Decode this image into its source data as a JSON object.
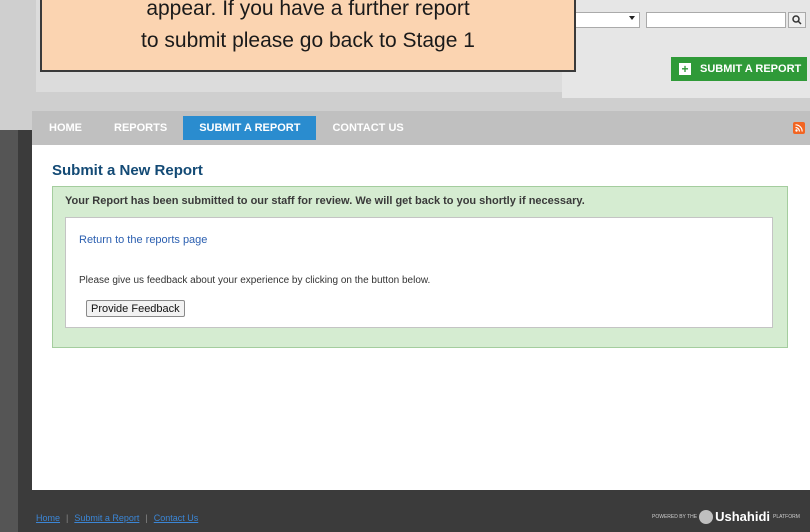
{
  "tooltip": {
    "line1": "appear. If you have a further report",
    "line2": "to submit please go back to Stage 1"
  },
  "header": {
    "submit_button": "SUBMIT A REPORT",
    "search": {
      "placeholder": ""
    }
  },
  "nav": {
    "items": [
      "HOME",
      "REPORTS",
      "SUBMIT A REPORT",
      "CONTACT US"
    ],
    "active": "SUBMIT A REPORT"
  },
  "main": {
    "title": "Submit a New Report",
    "success_message": "Your Report has been submitted to our staff for review. We will get back to you shortly if necessary.",
    "return_link": "Return to the reports page",
    "feedback_text": "Please give us feedback about your experience by clicking on the button below.",
    "feedback_button": "Provide Feedback"
  },
  "footer": {
    "links": [
      "Home",
      "Submit a Report",
      "Contact Us"
    ],
    "powered_prefix": "POWERED BY THE",
    "brand": "Ushahidi",
    "powered_suffix": "PLATFORM"
  },
  "colors": {
    "accent": "#2a8ccf",
    "submit_green": "#2f9a38",
    "title_blue": "#134a75",
    "success_bg": "#d5ecd1",
    "tooltip_bg": "#fbd4b1"
  },
  "icons": [
    "plus-icon",
    "search-icon",
    "rss-icon",
    "chevron-down-icon",
    "ushahidi-logo-icon"
  ]
}
